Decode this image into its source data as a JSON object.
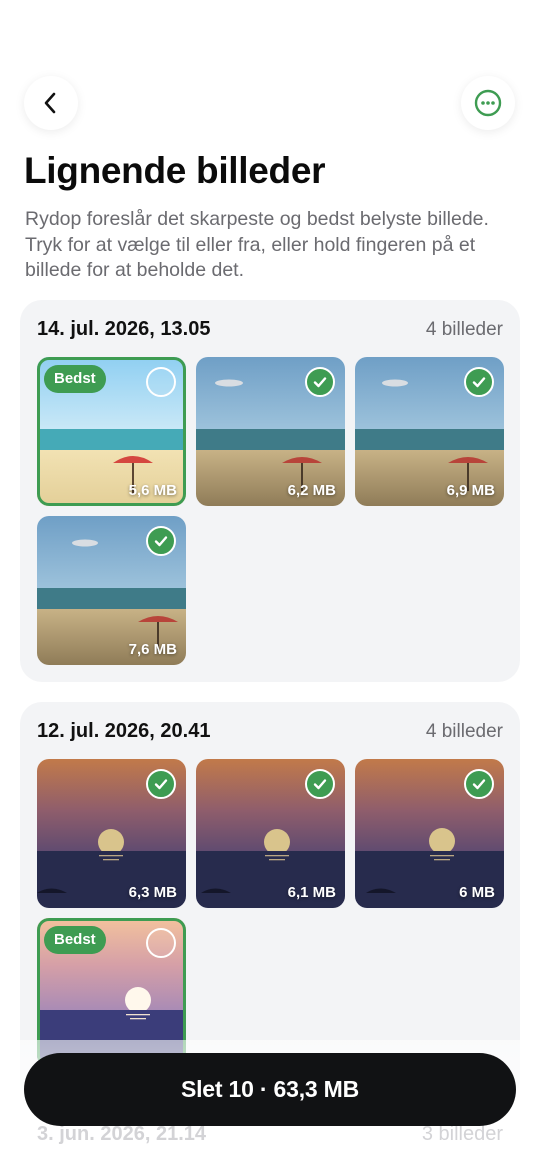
{
  "nav": {
    "back_icon": "chevron-left-icon",
    "more_icon": "ellipsis-circle-icon",
    "accent": "#3e9c52"
  },
  "header": {
    "title": "Lignende billeder",
    "subtitle": "Rydop foreslår det skarpeste og bedst belyste billede. Tryk for at vælge til eller fra, eller hold fingeren på et billede for at beholde det."
  },
  "groups": [
    {
      "date": "14. jul. 2026, 13.05",
      "count": "4 billeder",
      "photos": [
        {
          "size": "5,6 MB",
          "best": true,
          "selected": false,
          "badge": "Bedst"
        },
        {
          "size": "6,2 MB",
          "best": false,
          "selected": true
        },
        {
          "size": "6,9 MB",
          "best": false,
          "selected": true
        },
        {
          "size": "7,6 MB",
          "best": false,
          "selected": true
        }
      ]
    },
    {
      "date": "12. jul. 2026, 20.41",
      "count": "4 billeder",
      "photos": [
        {
          "size": "6,3 MB",
          "best": false,
          "selected": true
        },
        {
          "size": "6,1 MB",
          "best": false,
          "selected": true
        },
        {
          "size": "6 MB",
          "best": false,
          "selected": true
        },
        {
          "size": "",
          "best": true,
          "selected": false,
          "badge": "Bedst"
        }
      ]
    },
    {
      "date": "3. jun. 2026, 21.14",
      "count": "3 billeder"
    }
  ],
  "footer": {
    "delete_label": "Slet 10 · 63,3 MB"
  }
}
